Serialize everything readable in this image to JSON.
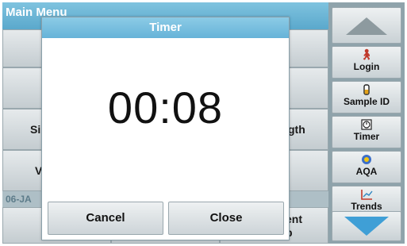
{
  "main_menu": {
    "title": "Main Menu",
    "partial_labels": {
      "row3_left": "Si",
      "row3_right": "gth",
      "row4_left": "V",
      "row6_right_top": "ent",
      "row6_right_bottom": "p"
    },
    "date": "06-JA"
  },
  "sidebar": {
    "items": [
      {
        "label": "Login",
        "icon": "person-icon"
      },
      {
        "label": "Sample ID",
        "icon": "vial-icon"
      },
      {
        "label": "Timer",
        "icon": "timer-icon"
      },
      {
        "label": "AQA",
        "icon": "aqa-icon"
      },
      {
        "label": "Trends",
        "icon": "trends-icon"
      }
    ]
  },
  "dialog": {
    "title": "Timer",
    "time": "00:08",
    "cancel_label": "Cancel",
    "close_label": "Close"
  },
  "colors": {
    "accent": "#66b3d8",
    "down_arrow": "#3f9fd6",
    "background": "#8a9fa8"
  }
}
